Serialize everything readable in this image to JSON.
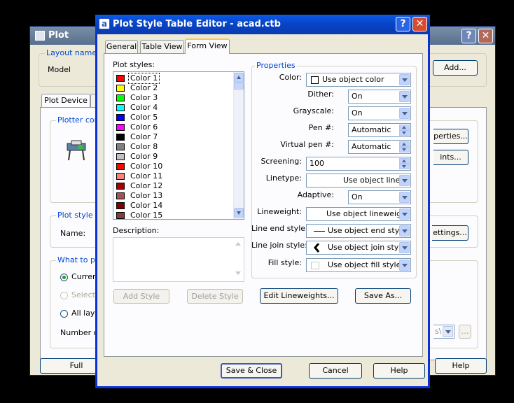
{
  "plot_window": {
    "title": "Plot",
    "help_glyph": "?",
    "close_glyph": "✕",
    "layout_name_label": "Layout name",
    "layout_name_value": "Model",
    "add_button": "Add...",
    "tab_plot_device": "Plot Device",
    "plotter_config_label": "Plotter con",
    "properties_button": "perties...",
    "hints_button": "ints...",
    "plot_style_label": "Plot style ta",
    "name_label": "Name:",
    "settings_button": "ettings...",
    "what_to_plot_label": "What to plo",
    "current_option": "Curren",
    "selected_option": "Selecte",
    "all_layouts_option": "All layo",
    "number_of_label": "Number of",
    "full_preview_button": "Full Preview",
    "help_button": "Help",
    "combo_partial": "s\\"
  },
  "dialog": {
    "title": "Plot Style Table Editor - acad.ctb",
    "app_glyph": "a",
    "help_glyph": "?",
    "close_glyph": "✕",
    "tabs": [
      "General",
      "Table View",
      "Form View"
    ],
    "plot_styles_label": "Plot styles:",
    "description_label": "Description:",
    "add_style_button": "Add Style",
    "delete_style_button": "Delete Style",
    "properties_label": "Properties",
    "properties": {
      "color_label": "Color:",
      "color_value": "Use object color",
      "dither_label": "Dither:",
      "dither_value": "On",
      "grayscale_label": "Grayscale:",
      "grayscale_value": "On",
      "pen_label": "Pen #:",
      "pen_value": "Automatic",
      "virtual_pen_label": "Virtual pen #:",
      "virtual_pen_value": "Automatic",
      "screening_label": "Screening:",
      "screening_value": "100",
      "linetype_label": "Linetype:",
      "linetype_value": "Use object linety",
      "adaptive_label": "Adaptive:",
      "adaptive_value": "On",
      "lineweight_label": "Lineweight:",
      "lineweight_value": "Use object lineweigh",
      "line_end_label": "Line end style:",
      "line_end_value": "Use object end style",
      "line_join_label": "Line join style:",
      "line_join_value": "Use object join style",
      "fill_label": "Fill style:",
      "fill_value": "Use object fill style"
    },
    "edit_lineweights_button": "Edit Lineweights...",
    "save_as_button": "Save As...",
    "save_close_button": "Save & Close",
    "cancel_button": "Cancel",
    "help_button": "Help",
    "styles": [
      {
        "name": "Color 1",
        "color": "#ff0000"
      },
      {
        "name": "Color 2",
        "color": "#ffff00"
      },
      {
        "name": "Color 3",
        "color": "#00ff00"
      },
      {
        "name": "Color 4",
        "color": "#00ffff"
      },
      {
        "name": "Color 5",
        "color": "#0000ff"
      },
      {
        "name": "Color 6",
        "color": "#ff00ff"
      },
      {
        "name": "Color 7",
        "color": "#000000"
      },
      {
        "name": "Color 8",
        "color": "#808080"
      },
      {
        "name": "Color 9",
        "color": "#c0c0c0"
      },
      {
        "name": "Color 10",
        "color": "#ff0000"
      },
      {
        "name": "Color 11",
        "color": "#ff7f7f"
      },
      {
        "name": "Color 12",
        "color": "#a50000"
      },
      {
        "name": "Color 13",
        "color": "#a55252"
      },
      {
        "name": "Color 14",
        "color": "#7f0000"
      },
      {
        "name": "Color 15",
        "color": "#7f3f3f"
      }
    ]
  }
}
